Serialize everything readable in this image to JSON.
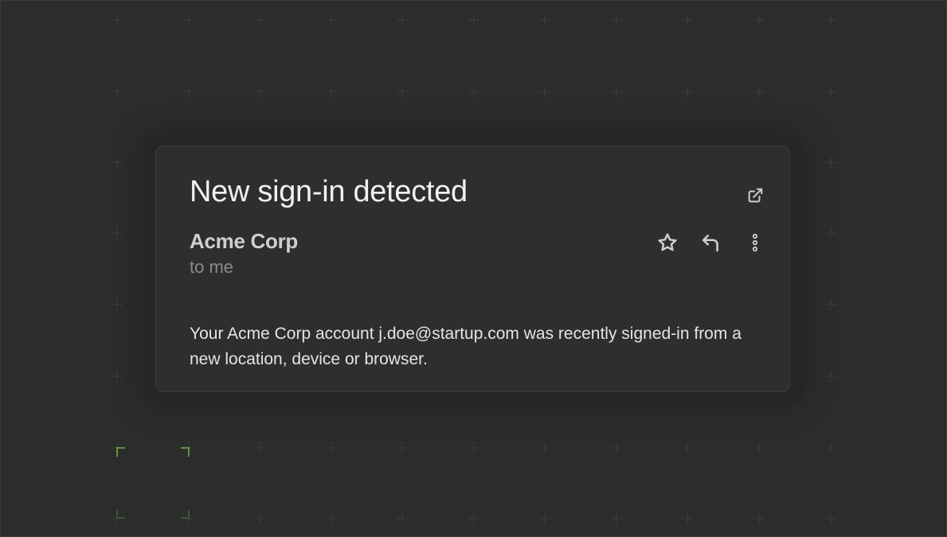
{
  "email": {
    "subject": "New sign-in detected",
    "sender": "Acme Corp",
    "recipient": "to me",
    "body": "Your Acme Corp account j.doe@startup.com was recently signed-in from a new location, device or browser."
  },
  "icons": {
    "open_external": "external-link-icon",
    "star": "star-icon",
    "reply": "reply-icon",
    "more": "more-vertical-icon"
  },
  "colors": {
    "background": "#2b2d2b",
    "card": "#2c2f2c",
    "accent_green": "#5a8a3c"
  }
}
